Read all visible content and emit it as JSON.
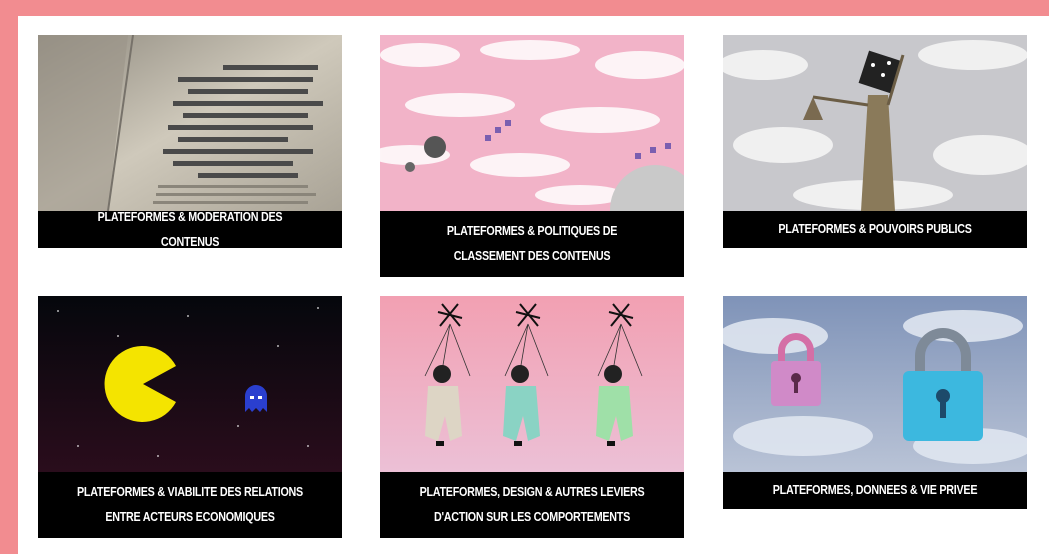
{
  "cards": [
    {
      "title": "PLATEFORMES & MODERATION DES CONTENUS",
      "image": "redacted-book-image"
    },
    {
      "title": "PLATEFORMES & POLITIQUES DE CLASSEMENT DES CONTENUS",
      "image": "pink-sky-planets-image"
    },
    {
      "title": "PLATEFORMES & POUVOIRS PUBLICS",
      "image": "lady-justice-image"
    },
    {
      "title": "PLATEFORMES & VIABILITE DES RELATIONS ENTRE ACTEURS ECONOMIQUES",
      "image": "pacman-space-image"
    },
    {
      "title": "PLATEFORMES, DESIGN & AUTRES LEVIERS D'ACTION SUR LES COMPORTEMENTS",
      "image": "marionettes-image"
    },
    {
      "title": "PLATEFORMES, DONNEES & VIE PRIVEE",
      "image": "padlocks-sky-image"
    }
  ],
  "colors": {
    "background": "#f28c90",
    "panel": "#ffffff",
    "caption_bg": "#000000",
    "caption_text": "#ffffff"
  }
}
